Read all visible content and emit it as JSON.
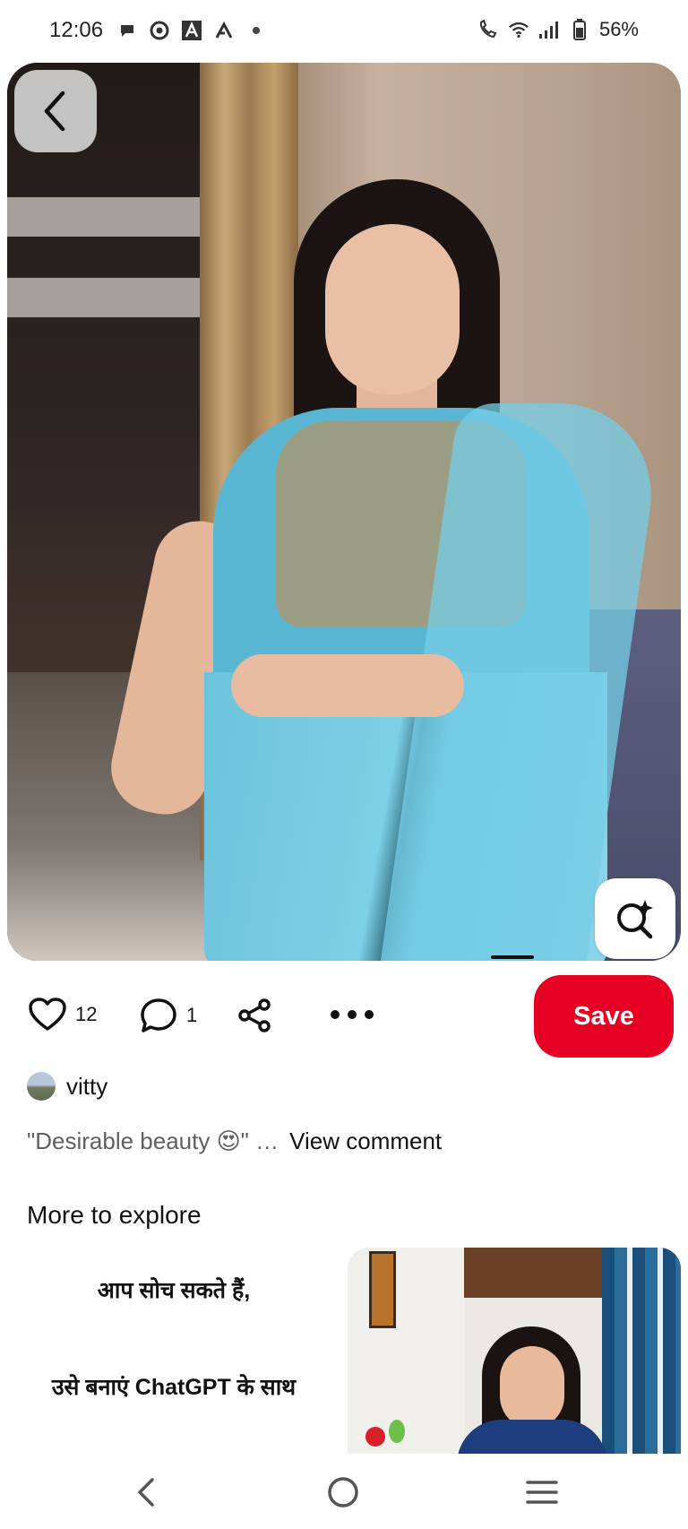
{
  "status_bar": {
    "time": "12:06",
    "left_icons": [
      "chat-bubble-icon",
      "chrome-icon",
      "a-app-icon",
      "a-outline-icon",
      "dot-icon"
    ],
    "right_icons": [
      "wifi-call-icon",
      "wifi-icon",
      "signal-icon",
      "battery-icon"
    ],
    "battery": "56%"
  },
  "pin": {
    "image_subject": "woman in light blue saree",
    "back_icon": "chevron-left-icon",
    "lens_icon": "visual-search-icon"
  },
  "actions": {
    "likes_icon": "heart-icon",
    "likes_count": "12",
    "comments_icon": "comment-icon",
    "comments_count": "1",
    "share_icon": "share-icon",
    "more_icon": "more-icon",
    "save_label": "Save",
    "accent_color": "#e60023"
  },
  "creator": {
    "name": "vitty"
  },
  "comment": {
    "text": "\"Desirable beauty 😍\" …",
    "view_label": "View comment"
  },
  "explore": {
    "title": "More to explore",
    "card1": {
      "line1": "आप सोच सकते हैं,",
      "line2": "उसे बनाएं ChatGPT के साथ"
    }
  },
  "nav": {
    "back_icon": "nav-back-icon",
    "home_icon": "nav-home-icon",
    "menu_icon": "nav-recents-icon"
  }
}
